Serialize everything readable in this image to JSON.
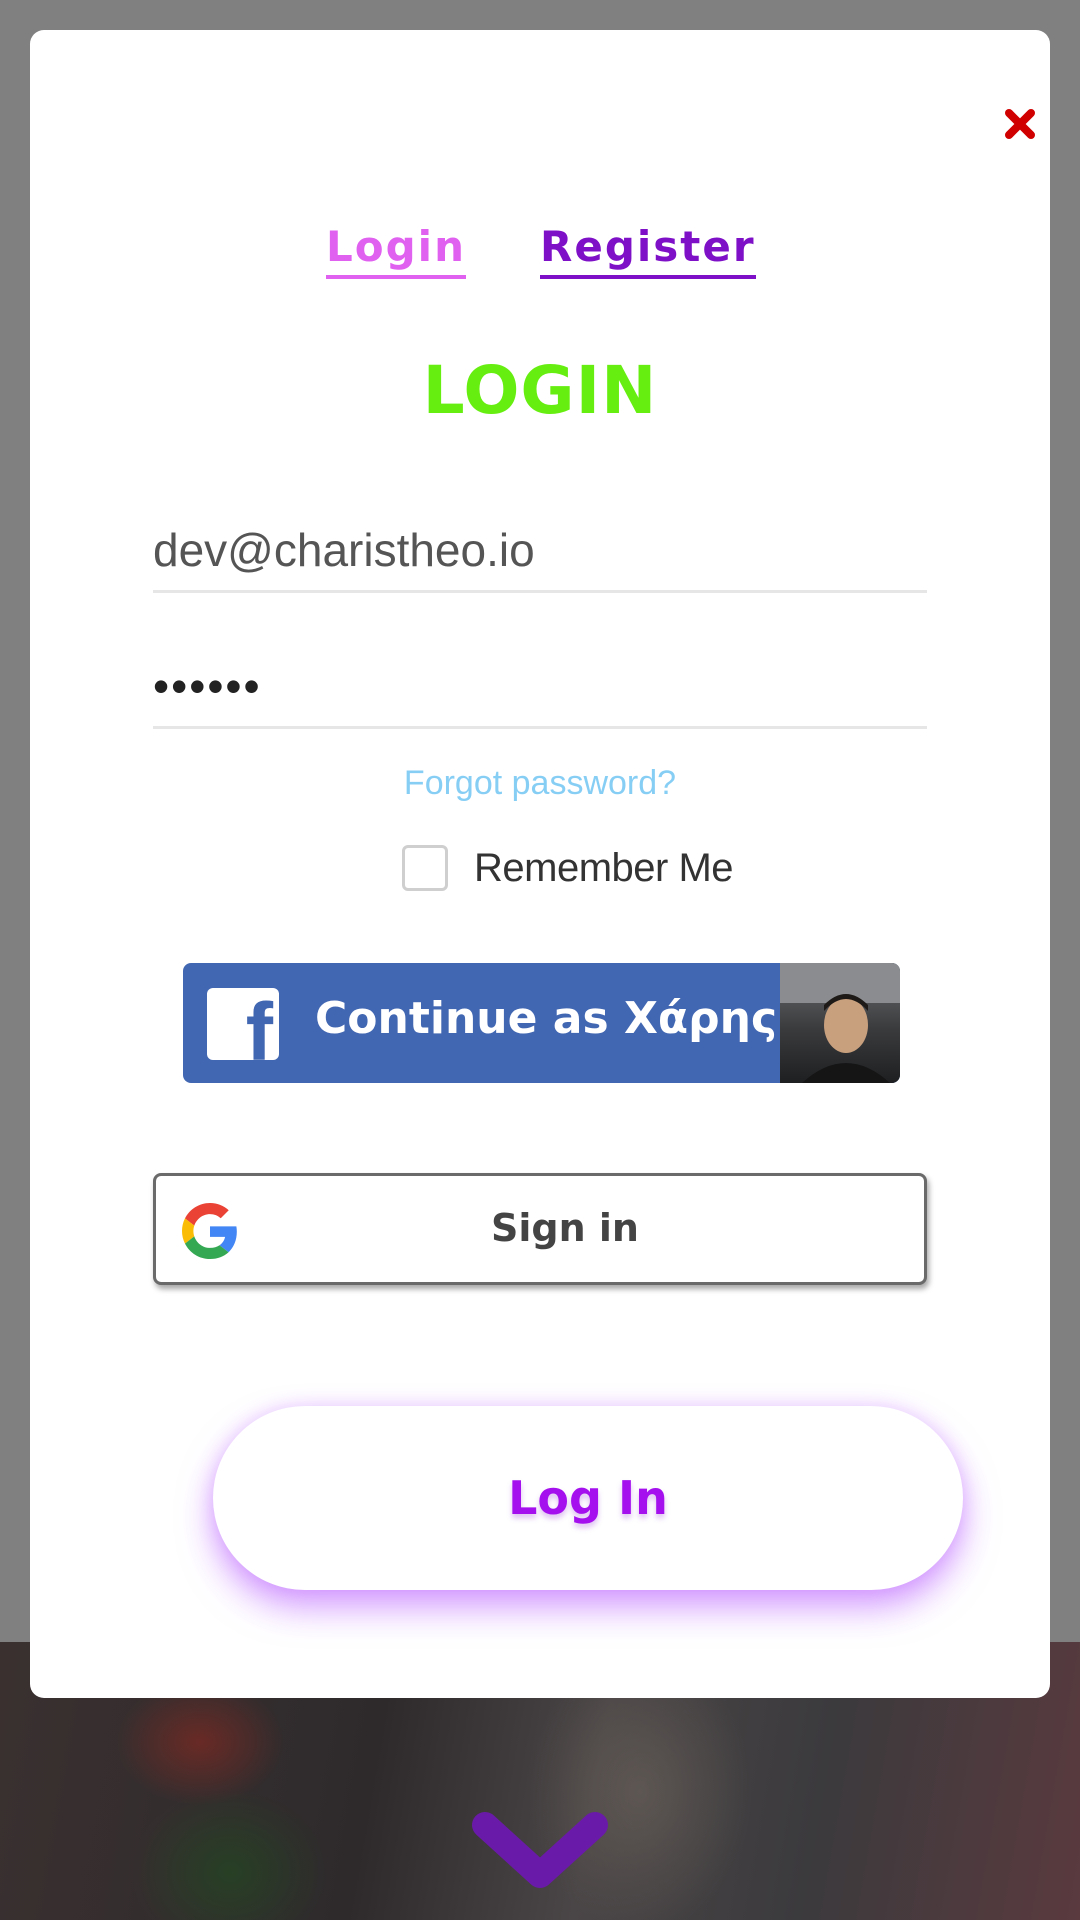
{
  "modal": {
    "close_icon": "close-icon",
    "tabs": [
      {
        "label": "Login",
        "active": true
      },
      {
        "label": "Register",
        "active": false
      }
    ],
    "heading": "LOGIN",
    "email": {
      "value": "dev@charistheo.io"
    },
    "password": {
      "value": "••••••"
    },
    "forgot_password": "Forgot password?",
    "remember_me": {
      "label": "Remember Me",
      "checked": false
    },
    "facebook_button": {
      "label": "Continue as Χάρης",
      "icon": "facebook-icon"
    },
    "google_button": {
      "label": "Sign in",
      "icon": "google-icon"
    },
    "login_button": {
      "label": "Log In"
    }
  },
  "colors": {
    "tab_active": "#e060f0",
    "tab_inactive": "#7e10c8",
    "heading": "#66ee10",
    "link": "#87cef5",
    "facebook": "#4267b2",
    "login_text": "#a411ee",
    "close": "#d00000",
    "overlay": "#808080"
  }
}
